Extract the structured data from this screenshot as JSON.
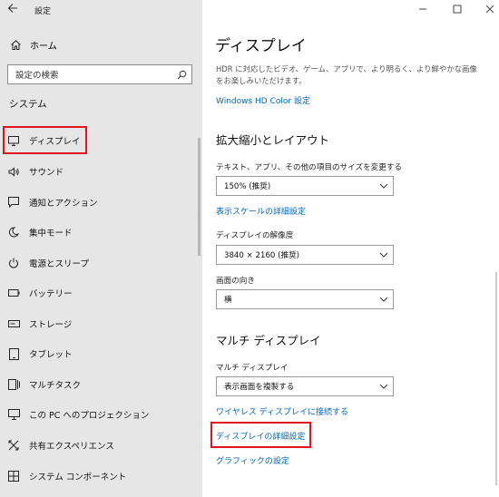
{
  "window": {
    "title": "設定"
  },
  "sidebar": {
    "home_label": "ホーム",
    "search_placeholder": "設定の検索",
    "section_label": "システム",
    "items": [
      {
        "label": "ディスプレイ",
        "icon": "monitor-icon"
      },
      {
        "label": "サウンド",
        "icon": "speaker-icon"
      },
      {
        "label": "通知とアクション",
        "icon": "notification-icon"
      },
      {
        "label": "集中モード",
        "icon": "moon-icon"
      },
      {
        "label": "電源とスリープ",
        "icon": "power-icon"
      },
      {
        "label": "バッテリー",
        "icon": "battery-icon"
      },
      {
        "label": "ストレージ",
        "icon": "storage-icon"
      },
      {
        "label": "タブレット",
        "icon": "tablet-icon"
      },
      {
        "label": "マルチタスク",
        "icon": "multitask-icon"
      },
      {
        "label": "この PC へのプロジェクション",
        "icon": "projection-icon"
      },
      {
        "label": "共有エクスペリエンス",
        "icon": "shared-experience-icon"
      },
      {
        "label": "システム コンポーネント",
        "icon": "components-icon"
      }
    ]
  },
  "main": {
    "title": "ディスプレイ",
    "hdr_desc": "HDR に対応したビデオ、ゲーム、アプリで、より明るく、より鮮やかな画像をお楽しみいただけます。",
    "hdr_link": "Windows HD Color 設定",
    "scale_heading": "拡大縮小とレイアウト",
    "scale_label": "テキスト、アプリ、その他の項目のサイズを変更する",
    "scale_value": "150% (推奨)",
    "scale_link": "表示スケールの詳細設定",
    "resolution_label": "ディスプレイの解像度",
    "resolution_value": "3840 × 2160 (推奨)",
    "orientation_label": "画面の向き",
    "orientation_value": "横",
    "multi_heading": "マルチ ディスプレイ",
    "multi_label": "マルチ ディスプレイ",
    "multi_value": "表示画面を複製する",
    "wireless_link": "ワイヤレス ディスプレイに接続する",
    "advanced_link": "ディスプレイの詳細設定",
    "graphics_link": "グラフィックの設定"
  },
  "colors": {
    "accent": "#0067c0",
    "highlight": "#e0141e",
    "sidebar_bg": "#e6e6e6"
  }
}
